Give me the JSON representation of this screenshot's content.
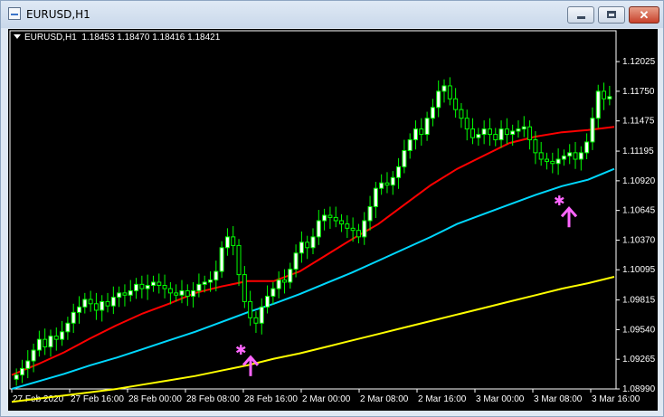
{
  "window": {
    "title": "EURUSD,H1",
    "minimize_label": "_",
    "maximize_label": "□",
    "close_label": "✕"
  },
  "header": {
    "symbol_period": "EURUSD,H1",
    "ohlc": "1.18453 1.18470 1.18416 1.18421"
  },
  "colors": {
    "background": "#000000",
    "axis": "#ffffff",
    "bull_candle": "#00ff00",
    "bull_body": "#ffffff",
    "ma_fast": "#ff0000",
    "ma_mid": "#00d8ff",
    "ma_slow": "#ffff00",
    "signal": "#ff66ff"
  },
  "chart_data": {
    "type": "line",
    "title": "EURUSD,H1",
    "price_ticks": [
      "1.12025",
      "1.11750",
      "1.11475",
      "1.11195",
      "1.10920",
      "1.10645",
      "1.10370",
      "1.10095",
      "1.09815",
      "1.09540",
      "1.09265",
      "1.08990"
    ],
    "time_ticks": [
      "27 Feb 2020",
      "27 Feb 16:00",
      "28 Feb 00:00",
      "28 Feb 08:00",
      "28 Feb 16:00",
      "2 Mar 00:00",
      "2 Mar 08:00",
      "2 Mar 16:00",
      "3 Mar 00:00",
      "3 Mar 08:00",
      "3 Mar 16:00"
    ],
    "ylim": [
      1.0899,
      1.1216
    ],
    "candles_close": [
      1.0912,
      1.0918,
      1.0925,
      1.0935,
      1.0945,
      1.0938,
      1.0948,
      1.0945,
      1.0952,
      1.096,
      1.097,
      1.0975,
      1.0982,
      1.0978,
      1.0972,
      1.098,
      1.0976,
      1.0984,
      1.0988,
      1.0986,
      1.099,
      1.0996,
      1.0992,
      1.0995,
      1.0998,
      1.0995,
      1.0992,
      1.0988,
      1.0986,
      1.099,
      1.0985,
      1.099,
      1.0996,
      1.0998,
      1.1,
      1.1008,
      1.103,
      1.104,
      1.1032,
      1.1005,
      1.098,
      1.0965,
      1.096,
      1.0975,
      1.0985,
      1.0992,
      1.1,
      1.0998,
      1.101,
      1.1025,
      1.1035,
      1.103,
      1.104,
      1.1055,
      1.106,
      1.1058,
      1.1055,
      1.1052,
      1.1048,
      1.1046,
      1.104,
      1.1055,
      1.1068,
      1.1085,
      1.109,
      1.1088,
      1.1095,
      1.1105,
      1.112,
      1.113,
      1.114,
      1.1135,
      1.115,
      1.116,
      1.1175,
      1.118,
      1.1168,
      1.1158,
      1.115,
      1.114,
      1.1132,
      1.1135,
      1.114,
      1.1135,
      1.113,
      1.114,
      1.1135,
      1.1138,
      1.114,
      1.1142,
      1.113,
      1.1118,
      1.1112,
      1.111,
      1.1108,
      1.1112,
      1.1115,
      1.1118,
      1.1112,
      1.1118,
      1.1128,
      1.115,
      1.1175,
      1.1168,
      1.117
    ],
    "series": [
      {
        "name": "",
        "color": "#ff0000",
        "values": [
          1.0912,
          1.0922,
          1.0933,
          1.0946,
          1.0958,
          1.0969,
          1.0978,
          1.0988,
          1.0994,
          1.0999,
          1.0999,
          1.1008,
          1.1023,
          1.1038,
          1.1052,
          1.107,
          1.1088,
          1.1103,
          1.1115,
          1.1127,
          1.1133,
          1.1137,
          1.1139,
          1.1142
        ]
      },
      {
        "name": "",
        "color": "#00d8ff",
        "values": [
          1.0899,
          1.0906,
          1.0913,
          1.0921,
          1.0928,
          1.0936,
          1.0944,
          1.0952,
          1.0961,
          1.097,
          1.0978,
          1.0987,
          1.0997,
          1.1007,
          1.1018,
          1.1029,
          1.104,
          1.1052,
          1.1061,
          1.107,
          1.1079,
          1.1087,
          1.1093,
          1.1103
        ]
      },
      {
        "name": "",
        "color": "#ffff00",
        "values": [
          1.0887,
          1.089,
          1.0893,
          1.0896,
          1.0899,
          1.0903,
          1.0907,
          1.0911,
          1.0916,
          1.0921,
          1.0927,
          1.0932,
          1.0938,
          1.0944,
          1.095,
          1.0956,
          1.0962,
          1.0968,
          1.0974,
          1.098,
          1.0986,
          1.0992,
          1.0997,
          1.1003
        ]
      }
    ],
    "signals": [
      {
        "type": "buy_arrow",
        "time": "28 Feb 16:00",
        "price": 1.0926
      },
      {
        "type": "buy_arrow",
        "time": "3 Mar 12:00",
        "price": 1.1064
      }
    ],
    "grid": false,
    "legend": "none"
  }
}
